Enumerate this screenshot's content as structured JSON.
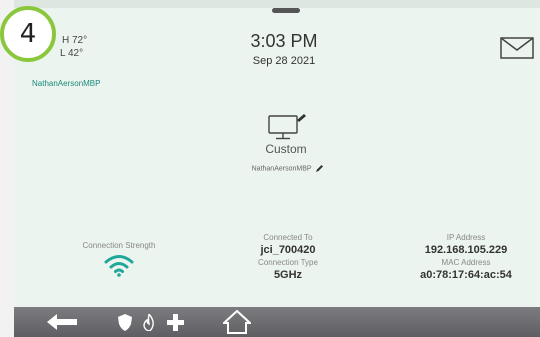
{
  "step_badge": "4",
  "weather": {
    "high": "H 72°",
    "low": "L 42°",
    "icon": "weather-icon"
  },
  "device_top_label": "NathanAersonMBP",
  "clock": {
    "time": "3:03 PM",
    "date": "Sep 28 2021"
  },
  "device": {
    "type_label": "Custom",
    "name": "NathanAersonMBP"
  },
  "connection_strength": {
    "label": "Connection Strength",
    "icon": "wifi-icon"
  },
  "connection": {
    "connected_to_label": "Connected To",
    "connected_to_value": "jci_700420",
    "type_label": "Connection Type",
    "type_value": "5GHz"
  },
  "network": {
    "ip_label": "IP Address",
    "ip_value": "192.168.105.229",
    "mac_label": "MAC Address",
    "mac_value": "a0:78:17:64:ac:54"
  },
  "colors": {
    "accent": "#8bc73c",
    "teal": "#1a8a7a",
    "wifi": "#1fa89a",
    "navbar": "#6b6b6f"
  },
  "navbar_icons": [
    "back-arrow-icon",
    "shield-icon",
    "fire-icon",
    "medical-cross-icon",
    "home-icon"
  ]
}
